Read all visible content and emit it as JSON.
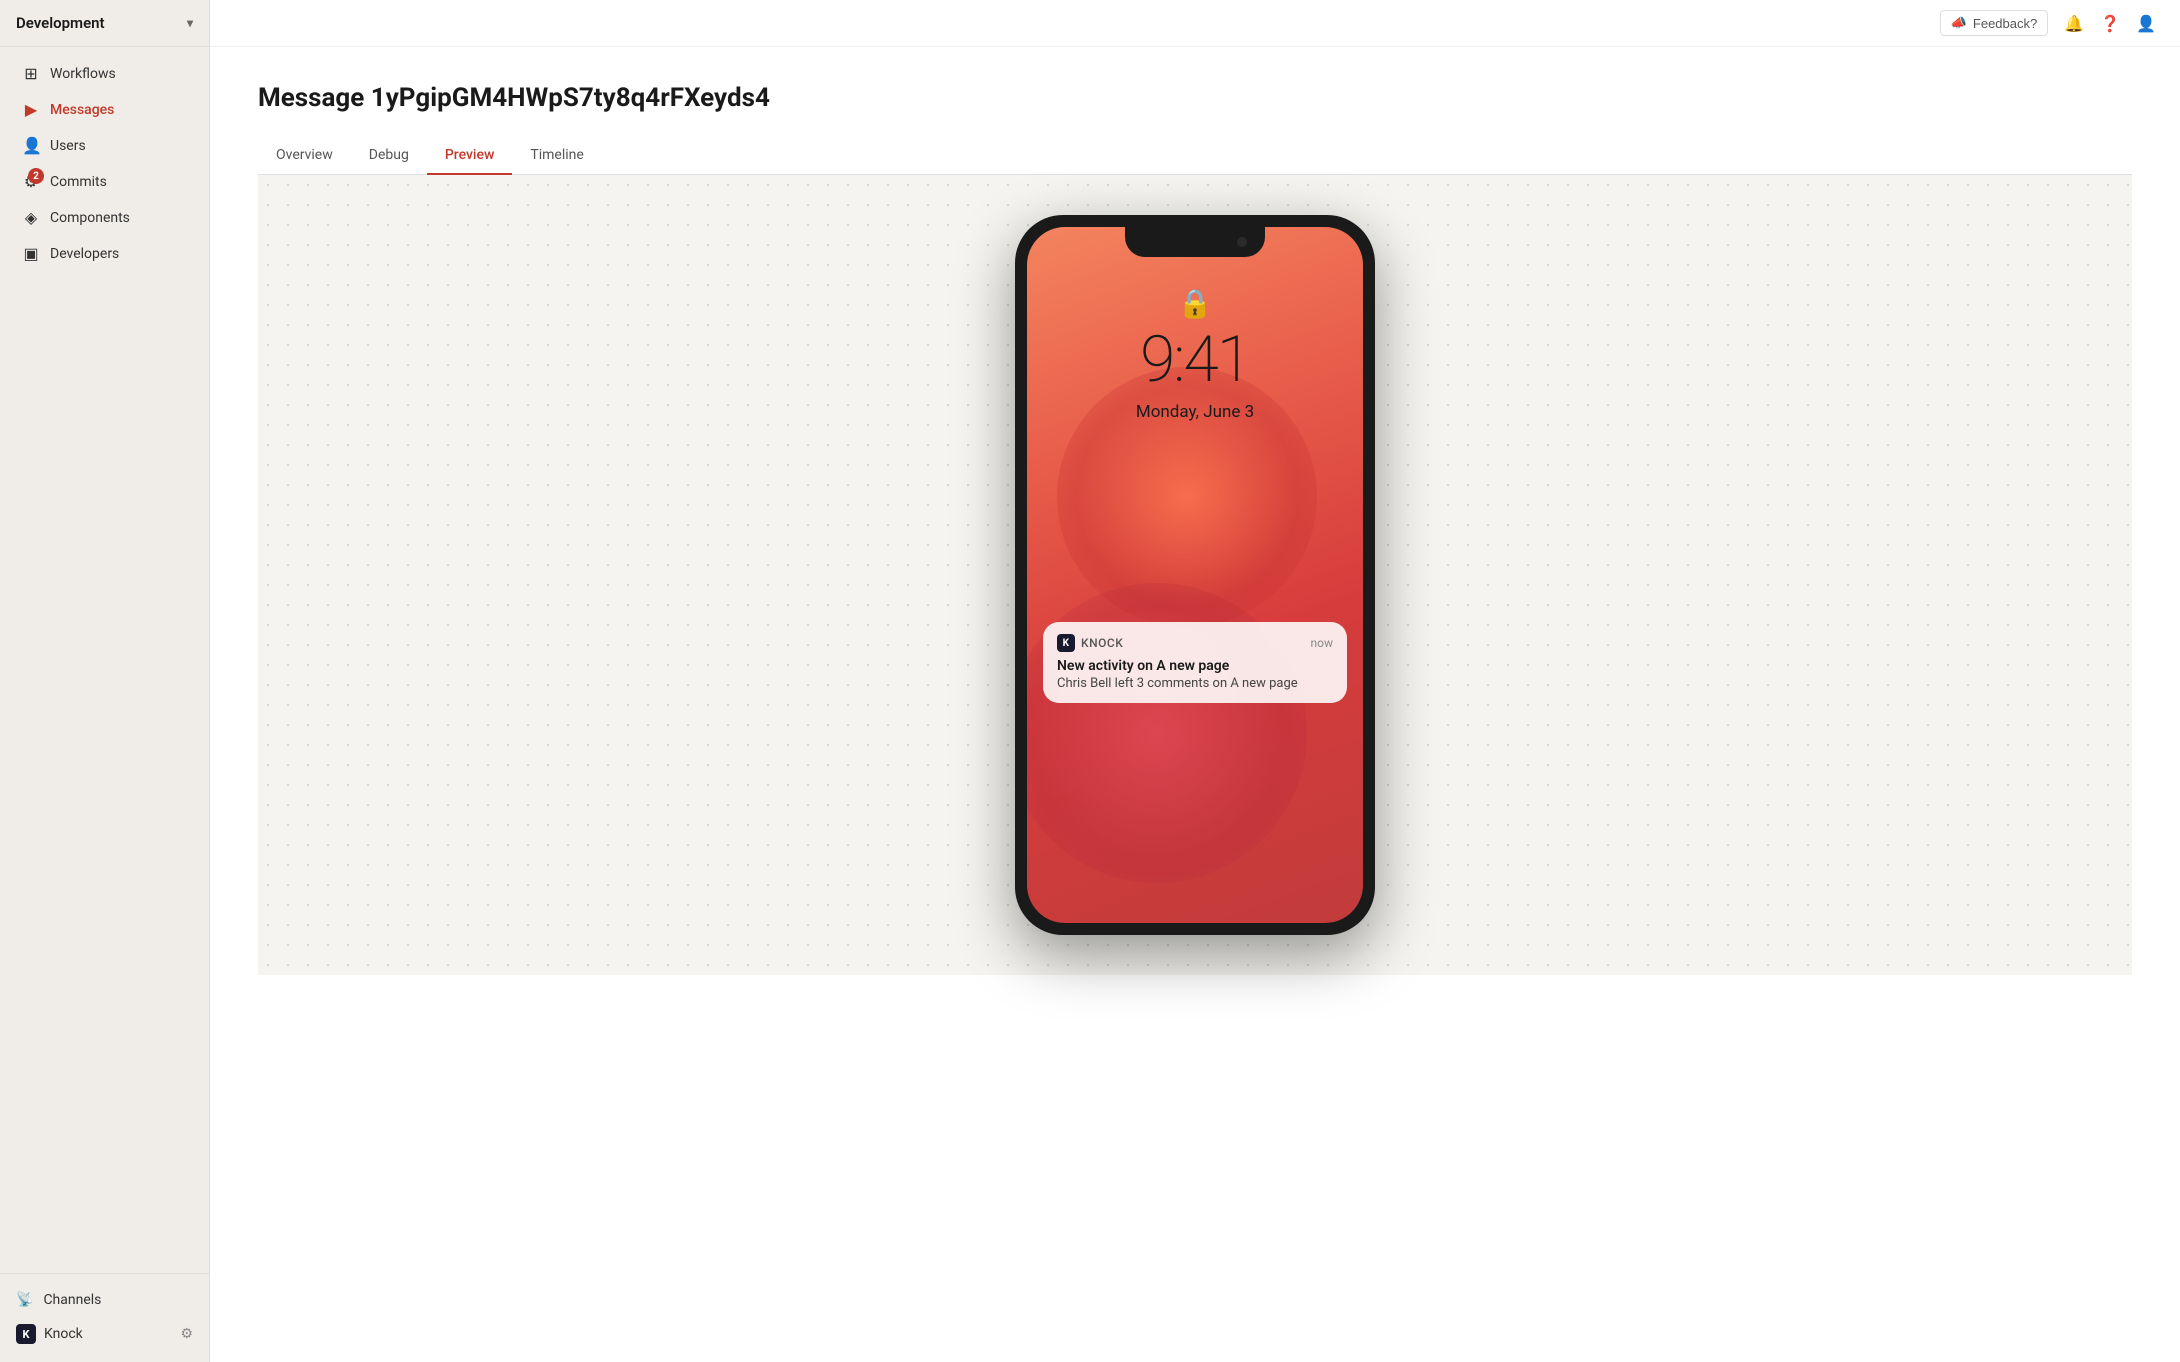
{
  "sidebar": {
    "header": {
      "title": "Development",
      "chevron": "▾"
    },
    "items": [
      {
        "id": "workflows",
        "label": "Workflows",
        "icon": "⊞",
        "active": false,
        "badge": null
      },
      {
        "id": "messages",
        "label": "Messages",
        "icon": "◁",
        "active": false,
        "badge": null
      },
      {
        "id": "users",
        "label": "Users",
        "icon": "👤",
        "active": false,
        "badge": null
      },
      {
        "id": "commits",
        "label": "Commits",
        "icon": "⚙",
        "active": false,
        "badge": "2"
      },
      {
        "id": "components",
        "label": "Components",
        "icon": "◈",
        "active": false,
        "badge": null
      },
      {
        "id": "developers",
        "label": "Developers",
        "icon": "▣",
        "active": false,
        "badge": null
      }
    ],
    "bottom": {
      "channels_label": "Channels",
      "knock_label": "Knock",
      "gear_label": "⚙"
    }
  },
  "topbar": {
    "feedback_label": "Feedback?",
    "bell_icon": "🔔",
    "help_icon": "?",
    "user_icon": "👤"
  },
  "page": {
    "title": "Message 1yPgipGM4HWpS7ty8q4rFXeyds4",
    "tabs": [
      {
        "id": "overview",
        "label": "Overview",
        "active": false
      },
      {
        "id": "debug",
        "label": "Debug",
        "active": false
      },
      {
        "id": "preview",
        "label": "Preview",
        "active": true
      },
      {
        "id": "timeline",
        "label": "Timeline",
        "active": false
      }
    ]
  },
  "phone": {
    "time": "9:41",
    "date": "Monday, June 3",
    "lock_icon": "🔒",
    "notification": {
      "app_name": "KNOCK",
      "time": "now",
      "title": "New activity on A new page",
      "body": "Chris Bell left 3 comments on A new page"
    }
  }
}
